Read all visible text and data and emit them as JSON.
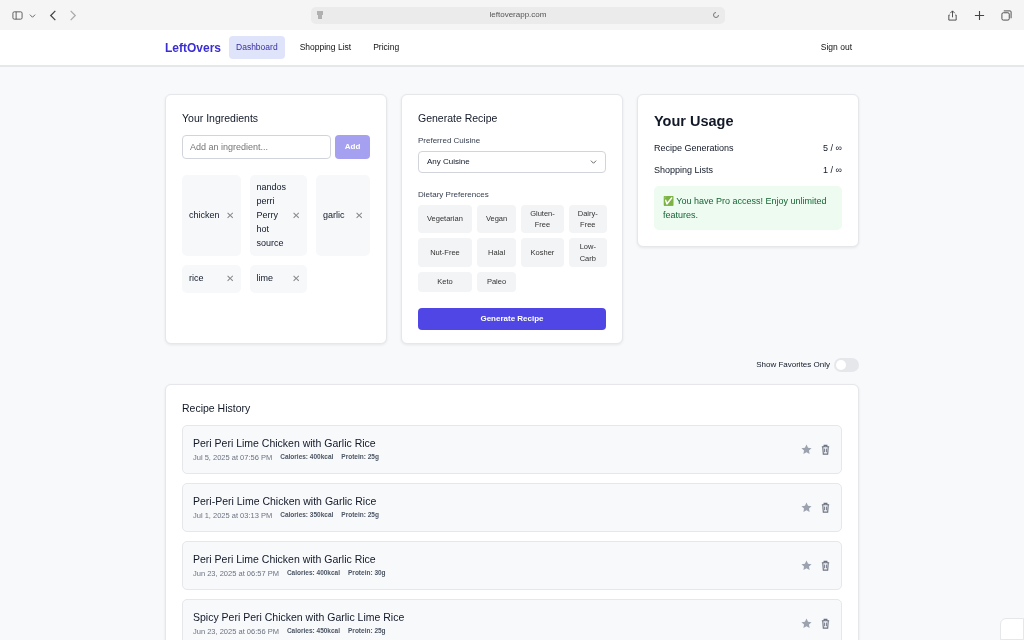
{
  "browser": {
    "url": "leftoverapp.com"
  },
  "nav": {
    "brand": "LeftOvers",
    "items": [
      {
        "label": "Dashboard",
        "selected": true
      },
      {
        "label": "Shopping List",
        "selected": false
      },
      {
        "label": "Pricing",
        "selected": false
      }
    ],
    "sign_out": "Sign out"
  },
  "ingredients": {
    "title": "Your Ingredients",
    "placeholder": "Add an ingredient...",
    "add_button": "Add",
    "remove_symbol": "✕",
    "items": [
      "chicken",
      "nandos perri Perry hot source",
      "garlic",
      "rice",
      "lime"
    ]
  },
  "generate": {
    "title": "Generate Recipe",
    "cuisine_label": "Preferred Cuisine",
    "cuisine_value": "Any Cuisine",
    "dietary_label": "Dietary Preferences",
    "dietary": [
      {
        "label": "Vegetarian",
        "selected": false
      },
      {
        "label": "Vegan",
        "selected": false
      },
      {
        "label": "Gluten-Free",
        "selected": false
      },
      {
        "label": "Dairy-Free",
        "selected": false
      },
      {
        "label": "Nut-Free",
        "selected": false
      },
      {
        "label": "Halal",
        "selected": false
      },
      {
        "label": "Kosher",
        "selected": false
      },
      {
        "label": "Low-Carb",
        "selected": false
      },
      {
        "label": "Keto",
        "selected": false
      },
      {
        "label": "Paleo",
        "selected": false
      }
    ],
    "button": "Generate Recipe"
  },
  "usage": {
    "title": "Your Usage",
    "rows": [
      {
        "label": "Recipe Generations",
        "value": "5 / ∞"
      },
      {
        "label": "Shopping Lists",
        "value": "1 / ∞"
      }
    ],
    "notice": "✅ You have Pro access! Enjoy unlimited features."
  },
  "favorites_toggle": {
    "label": "Show Favorites Only",
    "on": false
  },
  "history": {
    "title": "Recipe History",
    "recipes": [
      {
        "title": "Peri Peri Lime Chicken with Garlic Rice",
        "date": "Jul 5, 2025 at 07:56 PM",
        "calories": "Calories: 400kcal",
        "protein": "Protein: 25g",
        "favorite": false
      },
      {
        "title": "Peri-Peri Lime Chicken with Garlic Rice",
        "date": "Jul 1, 2025 at 03:13 PM",
        "calories": "Calories: 350kcal",
        "protein": "Protein: 25g",
        "favorite": false
      },
      {
        "title": "Peri Peri Lime Chicken with Garlic Rice",
        "date": "Jun 23, 2025 at 06:57 PM",
        "calories": "Calories: 400kcal",
        "protein": "Protein: 30g",
        "favorite": false
      },
      {
        "title": "Spicy Peri Peri Chicken with Garlic Lime Rice",
        "date": "Jun 23, 2025 at 06:56 PM",
        "calories": "Calories: 450kcal",
        "protein": "Protein: 25g",
        "favorite": false
      }
    ]
  }
}
